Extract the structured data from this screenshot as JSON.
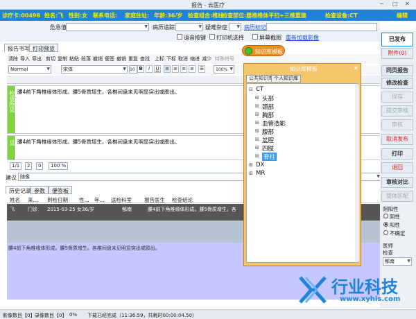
{
  "window": {
    "title": "报告 - 云医疗",
    "btn_min": "─",
    "btn_max": "□",
    "btn_close": "✕"
  },
  "info": {
    "visit_no": "诊疗卡:00498",
    "name": "姓名:飞",
    "sex": "性别:女",
    "phone": "联系电话:",
    "address": "家庭住址:",
    "age": "年龄:36/岁",
    "exam_group": "检查组合:椎柱",
    "exam_part": "检查部位:腰椎椎体平扫+三维重建",
    "device": "检查设备:CT",
    "edit": "编辑"
  },
  "form": {
    "critical_label": "危急值",
    "positive_label": "病历追踪",
    "doubt_label": "疑难杂症",
    "tag_link": "病历标记",
    "voice_label": "语音按键",
    "print_label": "打印机选择",
    "screenshot_label": "屏幕截图",
    "refresh_link": "重新加载影像"
  },
  "tabs": [
    "报告书写",
    "打印预览"
  ],
  "toolbar": [
    "清除",
    "导入",
    "导出",
    "剪切",
    "复制",
    "粘贴",
    "段落",
    "撤销",
    "便签",
    "撤销",
    "重复",
    "查找",
    "上标",
    "下标",
    "取消",
    "缩进",
    "减少",
    "特殊符号"
  ],
  "format": {
    "style": "Normal",
    "font": "宋体",
    "size": "10",
    "zoom": "100%"
  },
  "editor": {
    "findings_tab": "检查所见",
    "findings_text": "腰4前下角椎缘体形成。腰5骨质增生。各椎间盘未见明显突出或膨出。",
    "impression_tab": "检查意见",
    "impression_text": "腰4前下角椎缘体形成。腰5骨质增生。各椎间盘未见明显突出或膨出。"
  },
  "counters": [
    "1/1",
    "2",
    "0",
    "100 %"
  ],
  "suggest": {
    "label": "建议",
    "value": "随像"
  },
  "history": {
    "tabs": [
      "历史记录",
      "参数",
      "便签板"
    ],
    "columns": [
      "姓名",
      "来...",
      "到检日期",
      "性...",
      "年...",
      "送检科室",
      "报告医生",
      "检查结论"
    ],
    "row": {
      "name": "飞",
      "source": "门诊",
      "date": "2015-03-25 女",
      "age": "36/岁",
      "dept": "",
      "doctor": "郁南",
      "conclusion": "腰4前下角椎缘体形成。腰5骨质增生。各"
    },
    "detail": "腰4前下角椎缘体形成。腰5骨质增生。各椎间盘未见明显突出或膨出。"
  },
  "right_panel": {
    "publish": "已发布",
    "buttons": [
      "附件(0)",
      "同页报告",
      "修改检查",
      "保存",
      "提交审核",
      "审核",
      "取消发布",
      "打印",
      "退回",
      "审核对比",
      "整体区配"
    ],
    "yin_yang_label": "阴阳性",
    "radio_neg": "阴性",
    "radio_pos": "阳性",
    "radio_uncertain": "不确定",
    "doctor_label": "医师",
    "check_label": "检查",
    "doctor_value": "郁南"
  },
  "kb": {
    "float_label": "知识库模板",
    "title": "知识库模板",
    "tabs": [
      "公共知识库",
      "个人知识库"
    ],
    "tree": [
      {
        "label": "CT",
        "level": 0
      },
      {
        "label": "头部",
        "level": 1
      },
      {
        "label": "颈部",
        "level": 1
      },
      {
        "label": "胸部",
        "level": 1
      },
      {
        "label": "血管造影",
        "level": 1
      },
      {
        "label": "腹部",
        "level": 1
      },
      {
        "label": "盆腔",
        "level": 1
      },
      {
        "label": "四肢",
        "level": 1
      },
      {
        "label": "脊柱",
        "level": 1
      },
      {
        "label": "DX",
        "level": 0
      },
      {
        "label": "MR",
        "level": 0
      }
    ]
  },
  "status": {
    "image_count": "影像数目【0】",
    "record_count": "录像数目【0】",
    "progress": "0%",
    "message": "下载已经完成（11:36:59，共耗时00:00:04.50）"
  },
  "watermark": {
    "brand": "行业科技",
    "url": "www.xyhis.com"
  }
}
